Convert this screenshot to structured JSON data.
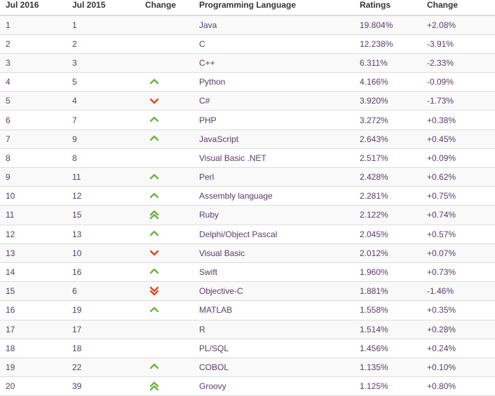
{
  "table": {
    "headers": {
      "rank_now": "Jul 2016",
      "rank_prev": "Jul 2015",
      "change": "Change",
      "language": "Programming Language",
      "ratings": "Ratings",
      "delta": "Change"
    },
    "colors": {
      "up_arrow": "#6cb33f",
      "down_arrow": "#e8461e",
      "header_text": "#333333",
      "rank_text": "#5b3a6b",
      "language_text": "#3a3f4b",
      "row_stripe": "#f9f9f9",
      "row_border": "#dddddd"
    },
    "rows": [
      {
        "rank_now": "1",
        "rank_prev": "1",
        "change_icon": "none",
        "language": "Java",
        "ratings": "19.804%",
        "delta": "+2.08%"
      },
      {
        "rank_now": "2",
        "rank_prev": "2",
        "change_icon": "none",
        "language": "C",
        "ratings": "12.238%",
        "delta": "-3.91%"
      },
      {
        "rank_now": "3",
        "rank_prev": "3",
        "change_icon": "none",
        "language": "C++",
        "ratings": "6.311%",
        "delta": "-2.33%"
      },
      {
        "rank_now": "4",
        "rank_prev": "5",
        "change_icon": "up",
        "language": "Python",
        "ratings": "4.166%",
        "delta": "-0.09%"
      },
      {
        "rank_now": "5",
        "rank_prev": "4",
        "change_icon": "down",
        "language": "C#",
        "ratings": "3.920%",
        "delta": "-1.73%"
      },
      {
        "rank_now": "6",
        "rank_prev": "7",
        "change_icon": "up",
        "language": "PHP",
        "ratings": "3.272%",
        "delta": "+0.38%"
      },
      {
        "rank_now": "7",
        "rank_prev": "9",
        "change_icon": "up",
        "language": "JavaScript",
        "ratings": "2.643%",
        "delta": "+0.45%"
      },
      {
        "rank_now": "8",
        "rank_prev": "8",
        "change_icon": "none",
        "language": "Visual Basic .NET",
        "ratings": "2.517%",
        "delta": "+0.09%"
      },
      {
        "rank_now": "9",
        "rank_prev": "11",
        "change_icon": "up",
        "language": "Perl",
        "ratings": "2.428%",
        "delta": "+0.62%"
      },
      {
        "rank_now": "10",
        "rank_prev": "12",
        "change_icon": "up",
        "language": "Assembly language",
        "ratings": "2.281%",
        "delta": "+0.75%"
      },
      {
        "rank_now": "11",
        "rank_prev": "15",
        "change_icon": "double-up",
        "language": "Ruby",
        "ratings": "2.122%",
        "delta": "+0.74%"
      },
      {
        "rank_now": "12",
        "rank_prev": "13",
        "change_icon": "up",
        "language": "Delphi/Object Pascal",
        "ratings": "2.045%",
        "delta": "+0.57%"
      },
      {
        "rank_now": "13",
        "rank_prev": "10",
        "change_icon": "down",
        "language": "Visual Basic",
        "ratings": "2.012%",
        "delta": "+0.07%"
      },
      {
        "rank_now": "14",
        "rank_prev": "16",
        "change_icon": "up",
        "language": "Swift",
        "ratings": "1.960%",
        "delta": "+0.73%"
      },
      {
        "rank_now": "15",
        "rank_prev": "6",
        "change_icon": "double-down",
        "language": "Objective-C",
        "ratings": "1.881%",
        "delta": "-1.46%"
      },
      {
        "rank_now": "16",
        "rank_prev": "19",
        "change_icon": "up",
        "language": "MATLAB",
        "ratings": "1.558%",
        "delta": "+0.35%"
      },
      {
        "rank_now": "17",
        "rank_prev": "17",
        "change_icon": "none",
        "language": "R",
        "ratings": "1.514%",
        "delta": "+0.28%"
      },
      {
        "rank_now": "18",
        "rank_prev": "18",
        "change_icon": "none",
        "language": "PL/SQL",
        "ratings": "1.456%",
        "delta": "+0.24%"
      },
      {
        "rank_now": "19",
        "rank_prev": "22",
        "change_icon": "up",
        "language": "COBOL",
        "ratings": "1.135%",
        "delta": "+0.10%"
      },
      {
        "rank_now": "20",
        "rank_prev": "39",
        "change_icon": "double-up",
        "language": "Groovy",
        "ratings": "1.125%",
        "delta": "+0.80%"
      }
    ]
  }
}
